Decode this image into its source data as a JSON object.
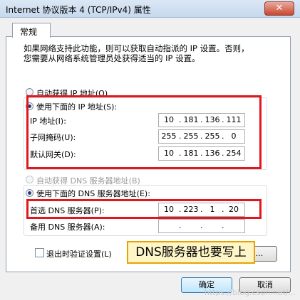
{
  "window": {
    "title": "Internet 协议版本 4 (TCP/IPv4) 属性",
    "close_label": "✕"
  },
  "tab": {
    "label": "常规"
  },
  "intro": "如果网络支持此功能，则可以获取自动指派的 IP 设置。否则，\n您需要从网络系统管理员处获得适当的 IP 设置。",
  "ip_section": {
    "auto_label": "自动获得 IP 地址(O)",
    "manual_label": "使用下面的 IP 地址(S):",
    "selected": "manual",
    "fields": [
      {
        "label": "IP 地址(I):",
        "octets": [
          "10",
          "181",
          "136",
          "111"
        ]
      },
      {
        "label": "子网掩码(U):",
        "octets": [
          "255",
          "255",
          "255",
          "0"
        ]
      },
      {
        "label": "默认网关(D):",
        "octets": [
          "10",
          "181",
          "136",
          "254"
        ]
      }
    ]
  },
  "dns_section": {
    "auto_label": "自动获得 DNS 服务器地址(B)",
    "manual_label": "使用下面的 DNS 服务器地址(E):",
    "selected": "manual",
    "fields": [
      {
        "label": "首选 DNS 服务器(P):",
        "octets": [
          "10",
          "223",
          "1",
          "20"
        ]
      },
      {
        "label": "备用 DNS 服务器(A):",
        "octets": [
          "",
          "",
          "",
          ""
        ]
      }
    ]
  },
  "validate_label": "退出时验证设置(L)",
  "advanced_label": "...",
  "ok_label": "确定",
  "cancel_label": "取消",
  "annotation": "DNS服务器也要写上",
  "colors": {
    "highlight": "#e3161c",
    "callout_bg": "#fff6c8",
    "callout_border": "#e8a100"
  },
  "watermark": "https://blog.csdn.net/..."
}
